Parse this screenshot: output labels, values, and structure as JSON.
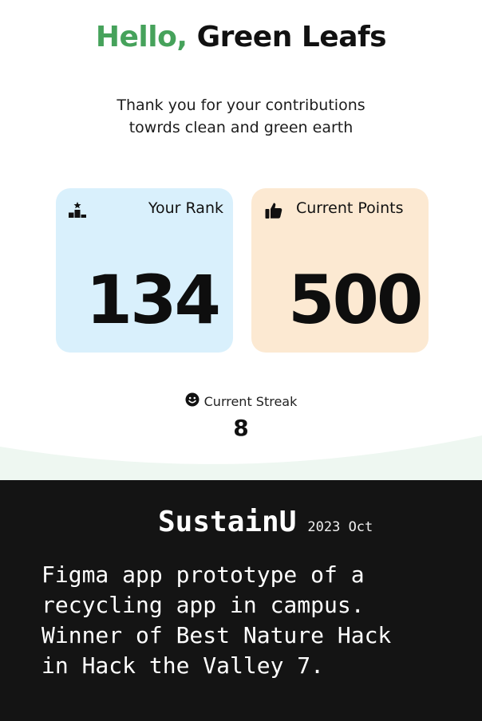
{
  "greeting": {
    "hello": "Hello,",
    "name": "Green Leafs"
  },
  "subtitle": {
    "line1": "Thank you for your contributions",
    "line2": "towrds clean and green earth"
  },
  "cards": {
    "rank": {
      "label": "Your Rank",
      "value": "134",
      "icon": "podium-icon",
      "color": "#d9f0fc"
    },
    "points": {
      "label": "Current Points",
      "value": "500",
      "icon": "thumbs-up-icon",
      "color": "#fce9d2"
    }
  },
  "streak": {
    "label": "Current Streak",
    "value": "8",
    "icon": "smiley-icon"
  },
  "colors": {
    "accent_green": "#46a25b",
    "caption_bg": "#141414",
    "wave_fill": "#eef7f1"
  },
  "caption": {
    "title": "SustainU",
    "date": "2023 Oct",
    "description_lines": [
      "Figma app prototype of a",
      "recycling app in campus.",
      "Winner of Best Nature Hack",
      "in Hack the Valley 7."
    ]
  }
}
